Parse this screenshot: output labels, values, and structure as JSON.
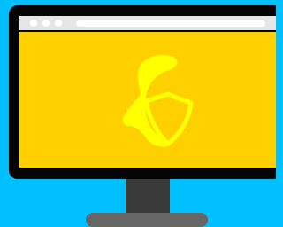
{
  "colors": {
    "background": "#00bfff",
    "bezel": "#050505",
    "browser_bar": "#e6e6e6",
    "screen": "#ffd000",
    "icon": "#ffff00",
    "stand": "#3a3a3a",
    "base": "#666666"
  },
  "icons": {
    "logo": "tux-icon",
    "security": "shield-icon"
  }
}
